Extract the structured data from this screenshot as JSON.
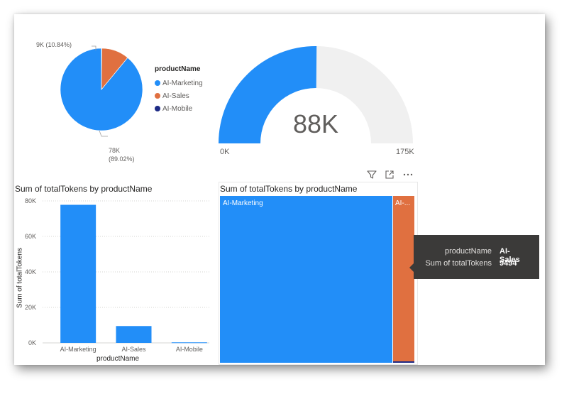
{
  "pie": {
    "legend_title": "productName",
    "legend_items": [
      {
        "label": "AI-Marketing",
        "color": "#228ef8"
      },
      {
        "label": "AI-Sales",
        "color": "#e07040"
      },
      {
        "label": "AI-Mobile",
        "color": "#1d2a85"
      }
    ],
    "label_small": "9K (10.84%)",
    "label_large_value": "78K",
    "label_large_pct": "(89.02%)"
  },
  "gauge": {
    "value_text": "88K",
    "min_label": "0K",
    "max_label": "175K",
    "fill_fraction": 0.5
  },
  "bar": {
    "title": "Sum of totalTokens by productName",
    "y_title": "Sum of totalTokens",
    "x_title": "productName",
    "y_ticks": [
      "80K",
      "60K",
      "40K",
      "20K",
      "0K"
    ],
    "categories": [
      "AI-Marketing",
      "AI-Sales",
      "AI-Mobile"
    ]
  },
  "treemap": {
    "title": "Sum of totalTokens by productName",
    "label_marketing": "AI-Marketing",
    "label_sales": "AI-..."
  },
  "toolbar": {
    "icons": [
      "filter-icon",
      "focus-mode-icon",
      "more-options-icon"
    ]
  },
  "tooltip": {
    "rows": [
      {
        "key": "productName",
        "value": "AI-Sales"
      },
      {
        "key": "Sum of totalTokens",
        "value": "9494"
      }
    ]
  },
  "colors": {
    "marketing": "#228ef8",
    "sales": "#e07040",
    "mobile": "#1d2a85",
    "gauge_bg": "#f0f0f0"
  },
  "chart_data": [
    {
      "type": "pie",
      "categories": [
        "AI-Marketing",
        "AI-Sales",
        "AI-Mobile"
      ],
      "values": [
        78000,
        9494,
        120
      ],
      "percent_labels": [
        "89.02%",
        "10.84%"
      ],
      "legend": "right"
    },
    {
      "type": "gauge",
      "value": 88000,
      "min": 0,
      "max": 175000
    },
    {
      "type": "bar",
      "title": "Sum of totalTokens by productName",
      "categories": [
        "AI-Marketing",
        "AI-Sales",
        "AI-Mobile"
      ],
      "values": [
        77800,
        9494,
        300
      ],
      "xlabel": "productName",
      "ylabel": "Sum of totalTokens",
      "ylim": [
        0,
        80000
      ],
      "grid": true
    },
    {
      "type": "treemap",
      "title": "Sum of totalTokens by productName",
      "categories": [
        "AI-Marketing",
        "AI-Sales",
        "AI-Mobile"
      ],
      "values": [
        77800,
        9494,
        300
      ]
    }
  ]
}
